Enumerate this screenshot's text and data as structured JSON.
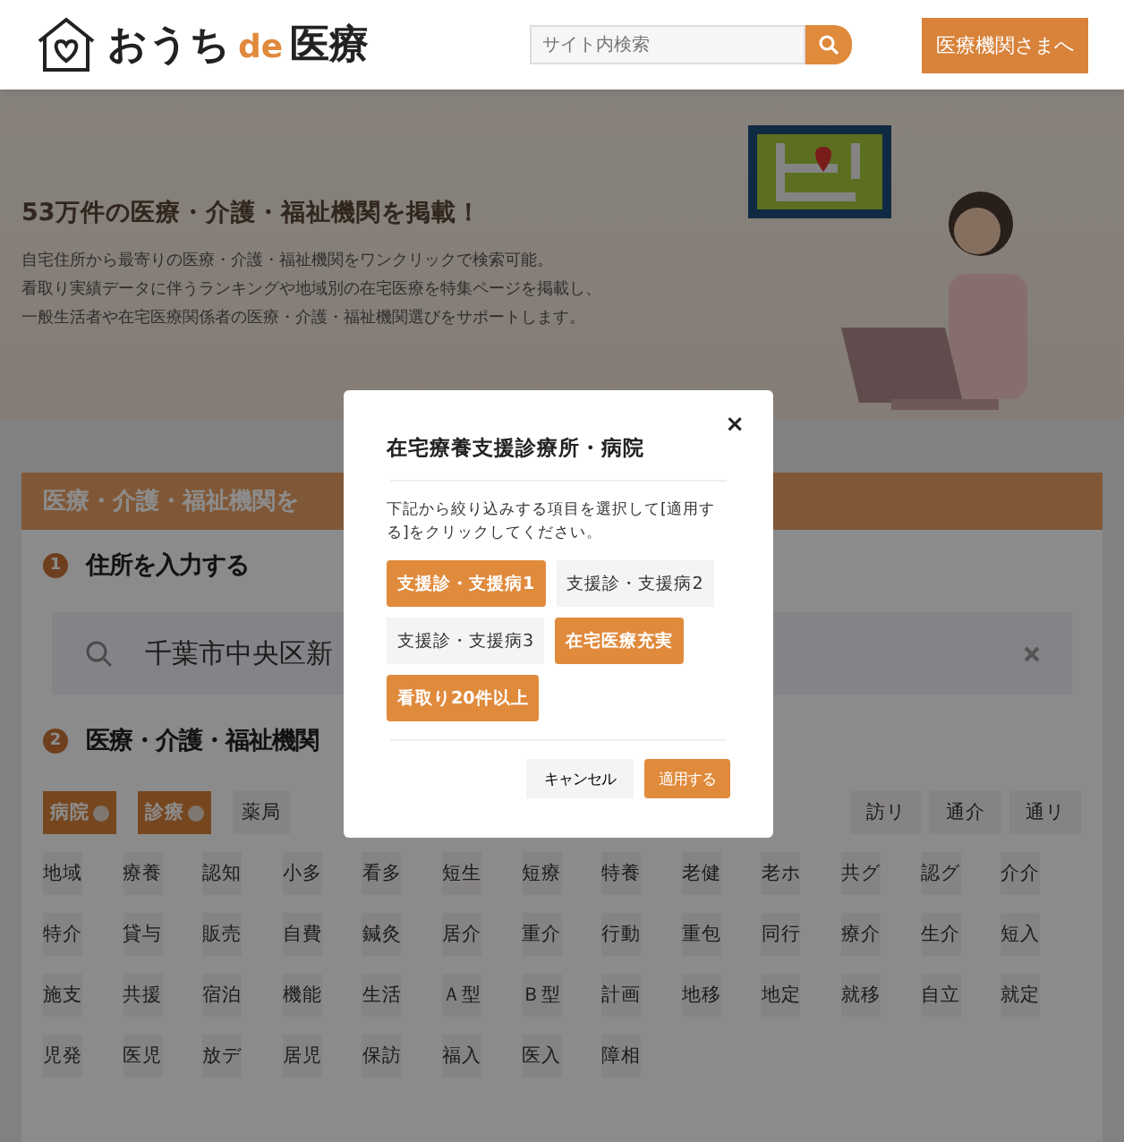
{
  "header": {
    "logo": {
      "part1": "おうち",
      "part2": "de",
      "part3": "医療"
    },
    "search": {
      "placeholder": "サイト内検索"
    },
    "facility_button": "医療機関さまへ"
  },
  "hero": {
    "headline": "53万件の医療・介護・福祉機関を掲載！",
    "lines": [
      "自宅住所から最寄りの医療・介護・福祉機関をワンクリックで検索可能。",
      "看取り実績データに伴うランキングや地域別の在宅医療を特集ページを掲載し、",
      "一般生活者や在宅医療関係者の医療・介護・福祉機関選びをサポートします。"
    ]
  },
  "search_section": {
    "title": "医療・介護・福祉機関を",
    "steps": [
      {
        "number": "1",
        "title": "住所を入力する"
      },
      {
        "number": "2",
        "title": "医療・介護・福祉機関"
      }
    ],
    "address": {
      "value": "千葉市中央区新"
    },
    "first_row_left": [
      {
        "label": "病院",
        "selected": true
      },
      {
        "label": "診療",
        "selected": true
      },
      {
        "label": "薬局",
        "selected": false
      }
    ],
    "first_row_right": [
      {
        "label": "訪リ",
        "selected": false
      },
      {
        "label": "通介",
        "selected": false
      },
      {
        "label": "通リ",
        "selected": false
      }
    ],
    "tag_rows": [
      [
        {
          "label": "地域",
          "selected": false
        },
        {
          "label": "療養",
          "selected": false
        },
        {
          "label": "認知",
          "selected": false
        },
        {
          "label": "小多",
          "selected": false
        },
        {
          "label": "看多",
          "selected": false
        },
        {
          "label": "短生",
          "selected": false
        },
        {
          "label": "短療",
          "selected": false
        },
        {
          "label": "特養",
          "selected": false
        },
        {
          "label": "老健",
          "selected": false
        },
        {
          "label": "老ホ",
          "selected": false
        },
        {
          "label": "共グ",
          "selected": false
        },
        {
          "label": "認グ",
          "selected": false
        },
        {
          "label": "介介",
          "selected": false
        }
      ],
      [
        {
          "label": "特介",
          "selected": false
        },
        {
          "label": "貸与",
          "selected": false
        },
        {
          "label": "販売",
          "selected": false
        },
        {
          "label": "自費",
          "selected": false
        },
        {
          "label": "鍼灸",
          "selected": false
        },
        {
          "label": "居介",
          "selected": false
        },
        {
          "label": "重介",
          "selected": false
        },
        {
          "label": "行動",
          "selected": false
        },
        {
          "label": "重包",
          "selected": false
        },
        {
          "label": "同行",
          "selected": false
        },
        {
          "label": "療介",
          "selected": false
        },
        {
          "label": "生介",
          "selected": false
        },
        {
          "label": "短入",
          "selected": false
        }
      ],
      [
        {
          "label": "施支",
          "selected": false
        },
        {
          "label": "共援",
          "selected": false
        },
        {
          "label": "宿泊",
          "selected": false
        },
        {
          "label": "機能",
          "selected": false
        },
        {
          "label": "生活",
          "selected": false
        },
        {
          "label": "Ａ型",
          "selected": false
        },
        {
          "label": "Ｂ型",
          "selected": false
        },
        {
          "label": "計画",
          "selected": false
        },
        {
          "label": "地移",
          "selected": false
        },
        {
          "label": "地定",
          "selected": false
        },
        {
          "label": "就移",
          "selected": false
        },
        {
          "label": "自立",
          "selected": false
        },
        {
          "label": "就定",
          "selected": false
        }
      ],
      [
        {
          "label": "児発",
          "selected": false
        },
        {
          "label": "医児",
          "selected": false
        },
        {
          "label": "放デ",
          "selected": false
        },
        {
          "label": "居児",
          "selected": false
        },
        {
          "label": "保訪",
          "selected": false
        },
        {
          "label": "福入",
          "selected": false
        },
        {
          "label": "医入",
          "selected": false
        },
        {
          "label": "障相",
          "selected": false
        }
      ]
    ]
  },
  "modal": {
    "title": "在宅療養支援診療所・病院",
    "close": "×",
    "description": "下記から絞り込みする項目を選択して[適用する]をクリックしてください。",
    "options": [
      {
        "label": "支援診・支援病1",
        "selected": true
      },
      {
        "label": "支援診・支援病2",
        "selected": false
      },
      {
        "label": "支援診・支援病3",
        "selected": false
      },
      {
        "label": "在宅医療充実",
        "selected": true
      },
      {
        "label": "看取り20件以上",
        "selected": true
      }
    ],
    "cancel": "キャンセル",
    "apply": "適用する"
  }
}
